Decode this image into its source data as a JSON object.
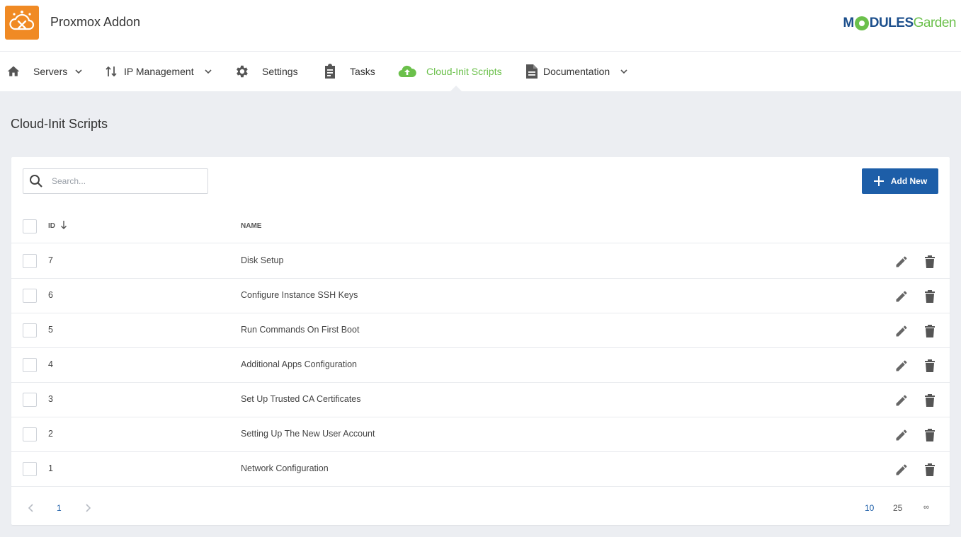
{
  "app": {
    "title": "Proxmox Addon",
    "brand_left": "M",
    "brand_mid": "DULES",
    "brand_right": "Garden"
  },
  "nav": {
    "items": [
      {
        "label": "Servers",
        "icon": "home-icon",
        "has_dropdown": true
      },
      {
        "label": "IP Management",
        "icon": "swap-vertical-icon",
        "has_dropdown": true
      },
      {
        "label": "Settings",
        "icon": "gear-icon",
        "has_dropdown": false
      },
      {
        "label": "Tasks",
        "icon": "clipboard-icon",
        "has_dropdown": false
      },
      {
        "label": "Cloud-Init Scripts",
        "icon": "cloud-upload-icon",
        "has_dropdown": false,
        "active": true
      },
      {
        "label": "Documentation",
        "icon": "document-icon",
        "has_dropdown": true
      }
    ]
  },
  "page": {
    "title": "Cloud-Init Scripts"
  },
  "toolbar": {
    "search_placeholder": "Search...",
    "add_label": "Add New"
  },
  "table": {
    "columns": [
      "ID",
      "NAME"
    ],
    "sort": {
      "column": "ID",
      "direction": "desc"
    },
    "rows": [
      {
        "id": "7",
        "name": "Disk Setup"
      },
      {
        "id": "6",
        "name": "Configure Instance SSH Keys"
      },
      {
        "id": "5",
        "name": "Run Commands On First Boot"
      },
      {
        "id": "4",
        "name": "Additional Apps Configuration"
      },
      {
        "id": "3",
        "name": "Set Up Trusted CA Certificates"
      },
      {
        "id": "2",
        "name": "Setting Up The New User Account"
      },
      {
        "id": "1",
        "name": "Network Configuration"
      }
    ]
  },
  "pagination": {
    "current": "1",
    "page_sizes": [
      "10",
      "25",
      "∞"
    ],
    "active_size": "10"
  },
  "colors": {
    "accent_green": "#6bc04b",
    "primary_blue": "#1d5ea8",
    "logo_orange": "#f08a24",
    "page_bg": "#eceef2"
  }
}
